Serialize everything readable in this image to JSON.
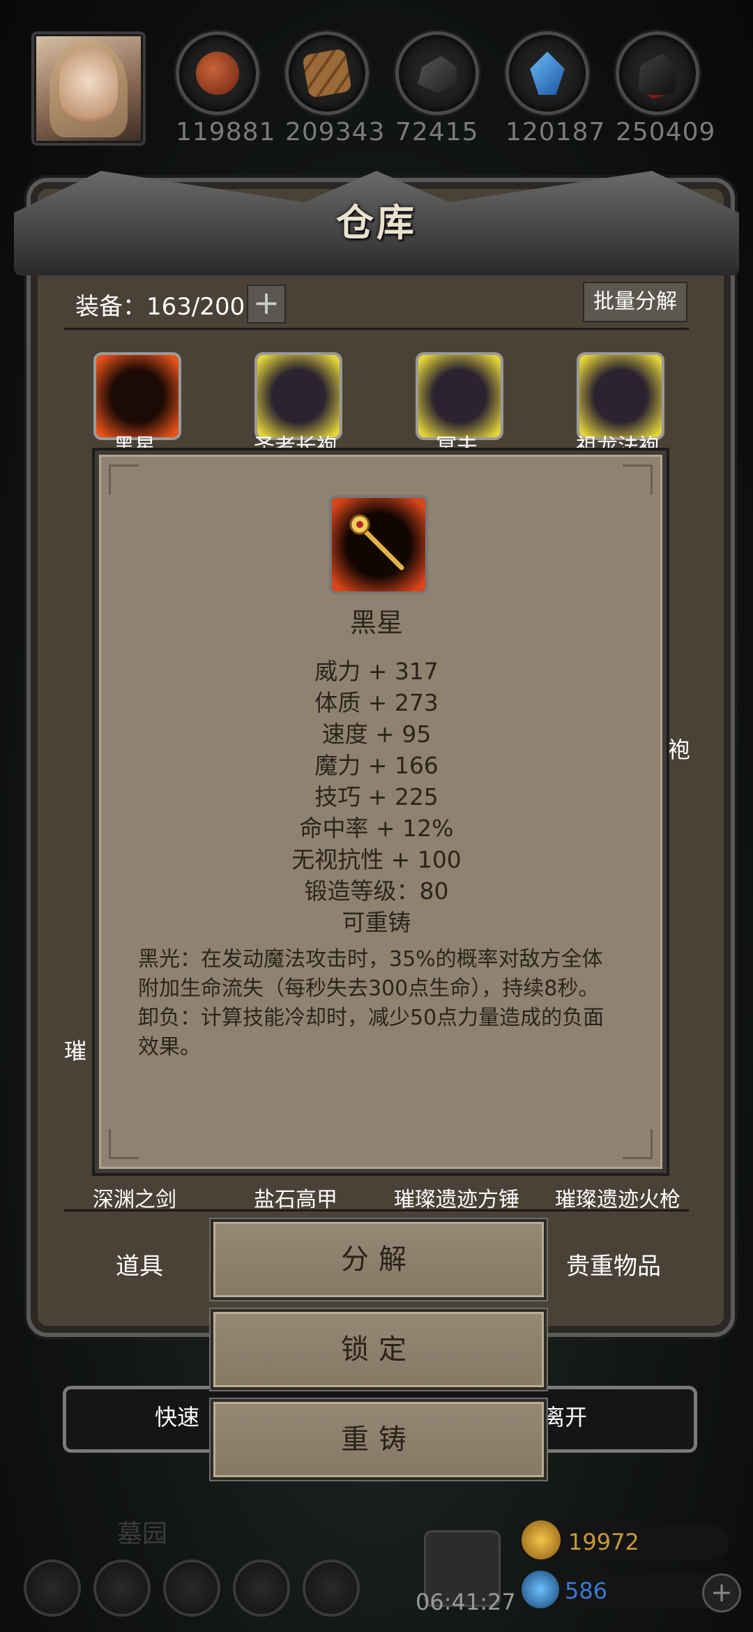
{
  "resources": [
    {
      "value": "119881",
      "icon": "meat-icon"
    },
    {
      "value": "209343",
      "icon": "wood-planks-icon"
    },
    {
      "value": "72415",
      "icon": "iron-ingot-icon"
    },
    {
      "value": "120187",
      "icon": "crystal-icon"
    },
    {
      "value": "250409",
      "icon": "coal-icon"
    }
  ],
  "warehouse": {
    "title": "仓库",
    "capacity_label": "装备：163/200",
    "add_label": "+",
    "batch_label": "批量分解",
    "items": [
      {
        "name": "黑星",
        "rarity": "red"
      },
      {
        "name": "圣者长袍",
        "rarity": "gold"
      },
      {
        "name": "冥夫",
        "rarity": "gold"
      },
      {
        "name": "祖龙法袍",
        "rarity": "gold"
      }
    ],
    "side_fragment_right": "袍",
    "side_fragment_left": "璀",
    "bottom_items": [
      "深渊之剑",
      "盐石高甲",
      "璀璨遗迹方锤",
      "璀璨遗迹火枪"
    ],
    "tab_left": "道具",
    "tab_right": "贵重物品"
  },
  "quickbar": {
    "left": "快速",
    "right": "离开"
  },
  "detail": {
    "name": "黑星",
    "stats": [
      "威力 + 317",
      "体质 + 273",
      "速度 + 95",
      "魔力 + 166",
      "技巧 + 225",
      "命中率 + 12%",
      "无视抗性 + 100",
      "锻造等级：80",
      "可重铸"
    ],
    "desc1": "黑光：在发动魔法攻击时，35%的概率对敌方全体附加生命流失（每秒失去300点生命），持续8秒。",
    "desc2": "卸负：计算技能冷却时，减少50点力量造成的负面效果。"
  },
  "actions": {
    "decompose": "分解",
    "lock": "锁定",
    "recast": "重铸"
  },
  "footer": {
    "location": "墓园",
    "gold": "19972",
    "gems": "586",
    "time": "06:41:27",
    "add": "+"
  },
  "colors": {
    "gold": "#e0a52b",
    "gem": "#3a7ad0"
  }
}
